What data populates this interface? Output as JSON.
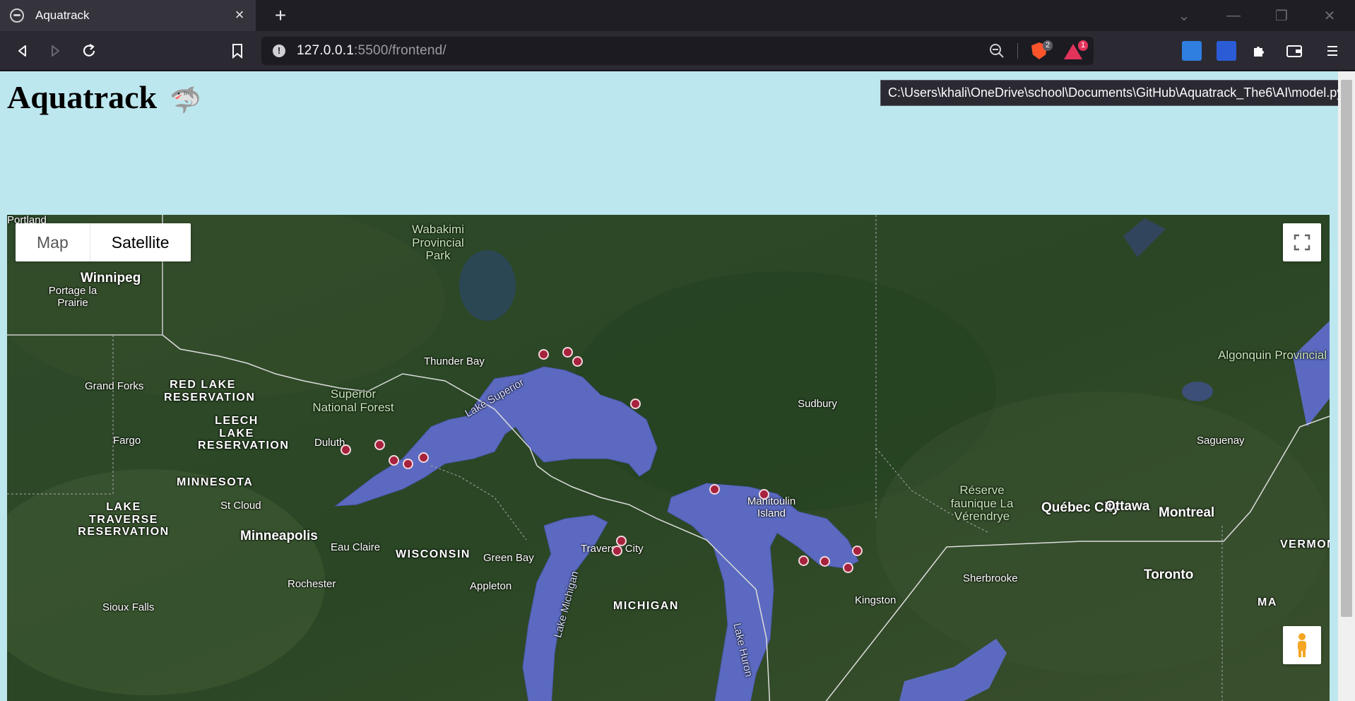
{
  "browser": {
    "tab_title": "Aquatrack",
    "url_host": "127.0.0.1",
    "url_rest": ":5500/frontend/",
    "shield_count": "2",
    "rewards_count": "1"
  },
  "page": {
    "title": "Aquatrack",
    "title_emoji": "🦈",
    "tooltip": "C:\\Users\\khali\\OneDrive\\school\\Documents\\GitHub\\Aquatrack_The6\\AI\\model.py"
  },
  "map": {
    "type_buttons": [
      "Map",
      "Satellite"
    ],
    "selected_type": "Satellite",
    "labels": [
      {
        "text": "Winnipeg",
        "kind": "big"
      },
      {
        "text": "Portage la Prairie",
        "kind": "city"
      },
      {
        "text": "Wabakimi Provincial Park",
        "kind": "park"
      },
      {
        "text": "Thunder Bay",
        "kind": "city"
      },
      {
        "text": "Superior National Forest",
        "kind": "park"
      },
      {
        "text": "Lake Superior",
        "kind": "water"
      },
      {
        "text": "Grand Forks",
        "kind": "city"
      },
      {
        "text": "RED LAKE RESERVATION",
        "kind": "region"
      },
      {
        "text": "LEECH LAKE RESERVATION",
        "kind": "region"
      },
      {
        "text": "Fargo",
        "kind": "city"
      },
      {
        "text": "Duluth",
        "kind": "city"
      },
      {
        "text": "MINNESOTA",
        "kind": "region"
      },
      {
        "text": "LAKE TRAVERSE RESERVATION",
        "kind": "region"
      },
      {
        "text": "St Cloud",
        "kind": "city"
      },
      {
        "text": "Minneapolis",
        "kind": "big"
      },
      {
        "text": "Eau Claire",
        "kind": "city"
      },
      {
        "text": "WISCONSIN",
        "kind": "region"
      },
      {
        "text": "Green Bay",
        "kind": "city"
      },
      {
        "text": "Appleton",
        "kind": "city"
      },
      {
        "text": "Rochester",
        "kind": "city"
      },
      {
        "text": "Sioux Falls",
        "kind": "city"
      },
      {
        "text": "Traverse City",
        "kind": "city"
      },
      {
        "text": "Lake Michigan",
        "kind": "water"
      },
      {
        "text": "MICHIGAN",
        "kind": "region"
      },
      {
        "text": "Lake Huron",
        "kind": "water"
      },
      {
        "text": "Manitoulin Island",
        "kind": "city"
      },
      {
        "text": "Sudbury",
        "kind": "city"
      },
      {
        "text": "Réserve faunique La Vérendrye",
        "kind": "park"
      },
      {
        "text": "Algonquin Provincial Park",
        "kind": "park"
      },
      {
        "text": "Saguenay",
        "kind": "city"
      },
      {
        "text": "Québec City",
        "kind": "big"
      },
      {
        "text": "Ottawa",
        "kind": "big"
      },
      {
        "text": "Montreal",
        "kind": "big"
      },
      {
        "text": "Sherbrooke",
        "kind": "city"
      },
      {
        "text": "Kingston",
        "kind": "city"
      },
      {
        "text": "Toronto",
        "kind": "big"
      },
      {
        "text": "VERMONT",
        "kind": "region"
      },
      {
        "text": "MA",
        "kind": "region"
      },
      {
        "text": "Portland",
        "kind": "city"
      }
    ],
    "marker_count": 17
  },
  "colors": {
    "page_bg": "#bde7ee",
    "lake": "#5b6ac0",
    "marker": "#a6223d"
  }
}
